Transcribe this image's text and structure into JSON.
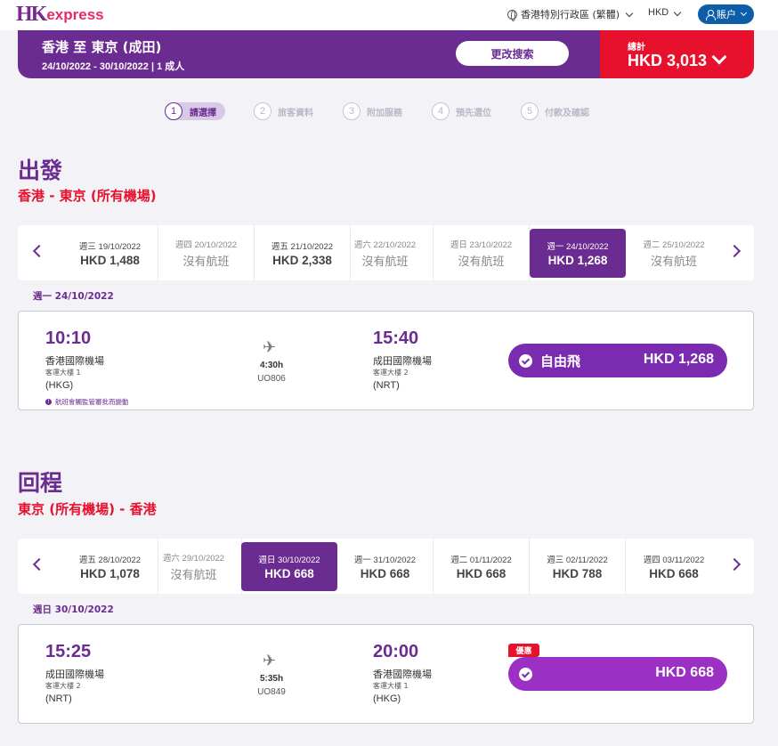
{
  "header": {
    "logo_mark": "HK",
    "logo_text": "express",
    "region_label": "香港特別行政區 (繁體)",
    "currency_label": "HKD",
    "account_label": "賬户"
  },
  "summary": {
    "route_title": "香港 至 東京 (成田)",
    "route_sub": "24/10/2022 - 30/10/2022 | 1 成人",
    "modify_label": "更改搜索",
    "total_label": "總計",
    "total_value": "HKD 3,013"
  },
  "steps": [
    {
      "num": "1",
      "label": "請選擇"
    },
    {
      "num": "2",
      "label": "旅客資料"
    },
    {
      "num": "3",
      "label": "附加服務"
    },
    {
      "num": "4",
      "label": "預先選位"
    },
    {
      "num": "5",
      "label": "付款及確認"
    }
  ],
  "outbound": {
    "title": "出發",
    "subtitle": "香港 - 東京 (所有機場)",
    "dates": [
      {
        "date": "週三 19/10/2022",
        "price": "HKD 1,488"
      },
      {
        "date": "週四 20/10/2022",
        "price": "沒有航班"
      },
      {
        "date": "週五 21/10/2022",
        "price": "HKD 2,338"
      },
      {
        "date": "週六 22/10/2022",
        "price": "沒有航班"
      },
      {
        "date": "週日 23/10/2022",
        "price": "沒有航班"
      },
      {
        "date": "週一 24/10/2022",
        "price": "HKD 1,268"
      },
      {
        "date": "週二 25/10/2022",
        "price": "沒有航班"
      }
    ],
    "day_label": "週一 24/10/2022",
    "flight": {
      "dep_time": "10:10",
      "dep_airport": "香港國際機場",
      "dep_terminal": "客運大樓 1",
      "dep_code": "(HKG)",
      "duration": "4:30h",
      "flight_no": "UO806",
      "arr_time": "15:40",
      "arr_airport": "成田國際機場",
      "arr_terminal": "客運大樓 2",
      "arr_code": "(NRT)",
      "note": "航班會觸監管審批而變動",
      "fare_name": "自由飛",
      "fare_price": "HKD 1,268"
    }
  },
  "inbound": {
    "title": "回程",
    "subtitle": "東京 (所有機場) - 香港",
    "dates": [
      {
        "date": "週五 28/10/2022",
        "price": "HKD 1,078"
      },
      {
        "date": "週六 29/10/2022",
        "price": "沒有航班"
      },
      {
        "date": "週日 30/10/2022",
        "price": "HKD 668"
      },
      {
        "date": "週一 31/10/2022",
        "price": "HKD 668"
      },
      {
        "date": "週二 01/11/2022",
        "price": "HKD 668"
      },
      {
        "date": "週三 02/11/2022",
        "price": "HKD 788"
      },
      {
        "date": "週四 03/11/2022",
        "price": "HKD 668"
      }
    ],
    "day_label": "週日 30/10/2022",
    "flight": {
      "dep_time": "15:25",
      "dep_airport": "成田國際機場",
      "dep_terminal": "客運大樓 2",
      "dep_code": "(NRT)",
      "duration": "5:35h",
      "flight_no": "UO849",
      "arr_time": "20:00",
      "arr_airport": "香港國際機場",
      "arr_terminal": "客運大樓 1",
      "arr_code": "(HKG)",
      "promo_badge": "優惠",
      "fare_price": "HKD 668"
    }
  },
  "colors": {
    "brand_purple": "#6b2c91",
    "brand_red": "#e8112d",
    "account_blue": "#0d5ea8"
  }
}
